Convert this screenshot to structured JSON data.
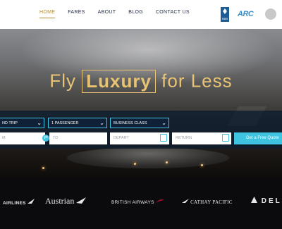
{
  "nav": {
    "items": [
      {
        "label": "HOME",
        "active": true
      },
      {
        "label": "FARES",
        "active": false
      },
      {
        "label": "ABOUT",
        "active": false
      },
      {
        "label": "BLOG",
        "active": false
      },
      {
        "label": "CONTACT US",
        "active": false
      }
    ],
    "badges": {
      "bbb": "BBB",
      "arc": "ARC"
    }
  },
  "hero": {
    "headline_pre": "Fly",
    "headline_highlight": "Luxury",
    "headline_post": "for Less"
  },
  "search_form": {
    "trip_type": "ND TRIP",
    "passengers": "1 PASSENGER",
    "cabin_class": "BUSINESS CLASS",
    "from_placeholder": "M",
    "to_placeholder": "TO",
    "depart_placeholder": "DEPART",
    "return_placeholder": "RETURN",
    "cta_label": "Get a Free Quote"
  },
  "airline_logos": [
    "AIRLINES",
    "Austrian",
    "BRITISH AIRWAYS",
    "CATHAY PACIFIC",
    "DEL"
  ],
  "colors": {
    "accent_gold": "#b38b2c",
    "headline_gold": "#e8c373",
    "cyan": "#3ec3e1",
    "nav_text": "#1f2a44"
  }
}
